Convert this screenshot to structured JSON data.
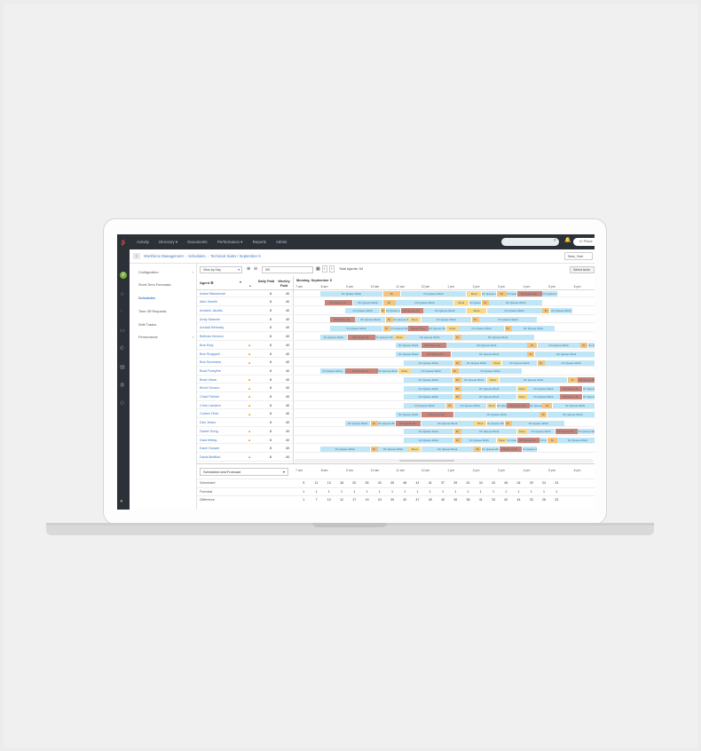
{
  "topbar": {
    "nav": [
      "Activity",
      "Directory ▾",
      "Documents",
      "Performance ▾",
      "Reports",
      "Admin"
    ],
    "user": "N. Prince"
  },
  "breadcrumb": {
    "wfm": "Workforce Management",
    "schedules": "Schedules",
    "current": "Technical Sales / September 9"
  },
  "timezone": "New_York",
  "sidenav": {
    "items": [
      {
        "label": "Configuration",
        "expand": "›"
      },
      {
        "label": "Short-Term Forecasts",
        "expand": ""
      },
      {
        "label": "Schedules",
        "expand": ""
      },
      {
        "label": "Time Off Requests",
        "expand": ""
      },
      {
        "label": "Shift Trades",
        "expand": ""
      },
      {
        "label": "Performance",
        "expand": "›"
      }
    ]
  },
  "toolbar": {
    "view_by": "View by Day",
    "date": "9/9",
    "total_agents": "Total Agents: 54",
    "select_action": "Select Actio"
  },
  "table_header": {
    "agent": "Agent ⚙",
    "daily_paid": "Daily Paid",
    "weekly_paid": "Weekly Paid",
    "day_label": "Monday, September 9",
    "hours": [
      "7 am",
      "8 am",
      "9 am",
      "10 am",
      "11 am",
      "12 pm",
      "1 pm",
      "2 pm",
      "3 pm",
      "4 pm",
      "5 pm",
      "6 pm"
    ]
  },
  "agents": [
    {
      "name": "Adam Mackenzie",
      "warn": false,
      "daily": "8",
      "weekly": "40"
    },
    {
      "name": "Alex Smelik",
      "warn": false,
      "daily": "8",
      "weekly": "40"
    },
    {
      "name": "Andrew Jacobs",
      "warn": false,
      "daily": "8",
      "weekly": "40"
    },
    {
      "name": "Andy Naseeb",
      "warn": false,
      "daily": "8",
      "weekly": "40"
    },
    {
      "name": "Arshad Behrady",
      "warn": false,
      "daily": "8",
      "weekly": "40"
    },
    {
      "name": "Belinda Herrera",
      "warn": false,
      "daily": "8",
      "weekly": "40"
    },
    {
      "name": "Bob King",
      "warn": true,
      "daily": "8",
      "weekly": "40"
    },
    {
      "name": "Bob Shappell",
      "warn": true,
      "daily": "8",
      "weekly": "40"
    },
    {
      "name": "Bob Summers",
      "warn": true,
      "daily": "8",
      "weekly": "40"
    },
    {
      "name": "Brad Forsythe",
      "warn": false,
      "daily": "8",
      "weekly": "40"
    },
    {
      "name": "Brad Urban",
      "warn": true,
      "daily": "8",
      "weekly": "40"
    },
    {
      "name": "Brent Orosco",
      "warn": true,
      "daily": "8",
      "weekly": "40"
    },
    {
      "name": "Chad Palmer",
      "warn": true,
      "daily": "8",
      "weekly": "40"
    },
    {
      "name": "Chris Landers",
      "warn": true,
      "daily": "8",
      "weekly": "40"
    },
    {
      "name": "Coleen Finle",
      "warn": true,
      "daily": "8",
      "weekly": "40"
    },
    {
      "name": "Dan Jeans",
      "warn": false,
      "daily": "8",
      "weekly": "40"
    },
    {
      "name": "Daniel Song",
      "warn": true,
      "daily": "8",
      "weekly": "40"
    },
    {
      "name": "Dara Melay",
      "warn": true,
      "daily": "8",
      "weekly": "40"
    },
    {
      "name": "Dave Gusam",
      "warn": false,
      "daily": "8",
      "weekly": "40"
    },
    {
      "name": "David Butifido",
      "warn": true,
      "daily": "8",
      "weekly": "40"
    }
  ],
  "segment_colors": {
    "queue": "#bfe6f6",
    "break": "#f5c37a",
    "offqueue": "#c98579",
    "meal": "#f8d98a"
  },
  "schedule_labels": {
    "queue": "On Queue Work",
    "email": "Email Time",
    "meal": "Meal",
    "break": "Br",
    "offqueue": "Off Queue W..."
  },
  "summary": {
    "selector": "Scheduled and Forecast",
    "rows": [
      {
        "label": "Scheduled",
        "values": [
          "",
          "9",
          "11",
          "13",
          "18",
          "20",
          "35",
          "43",
          "45",
          "48",
          "41",
          "41",
          "37",
          "39",
          "42",
          "34",
          "43",
          "45",
          "34",
          "29",
          "24",
          "24"
        ]
      },
      {
        "label": "Forecast",
        "values": [
          "",
          "1",
          "1",
          "1",
          "1",
          "1",
          "1",
          "1",
          "1",
          "1",
          "1",
          "1",
          "1",
          "1",
          "1",
          "1",
          "1",
          "1",
          "1",
          "1",
          "1",
          "1"
        ]
      },
      {
        "label": "Difference",
        "values": [
          "",
          "1",
          "7",
          "10",
          "12",
          "17",
          "19",
          "24",
          "39",
          "42",
          "47",
          "40",
          "40",
          "36",
          "38",
          "41",
          "33",
          "42",
          "44",
          "33",
          "26",
          "23"
        ]
      }
    ]
  }
}
